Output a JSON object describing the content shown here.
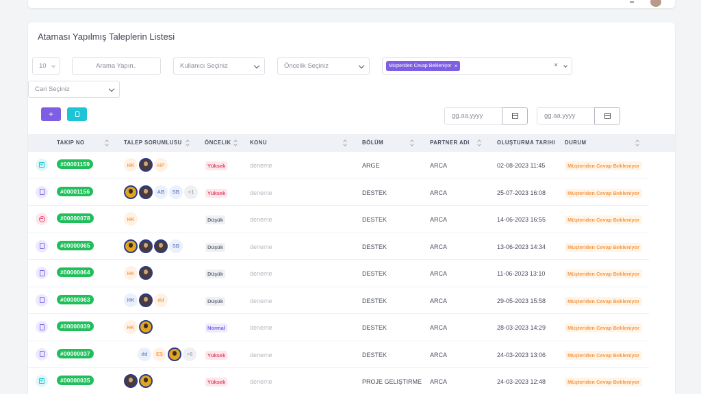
{
  "card": {
    "title": "Ataması Yapılmış Taleplerin Listesi"
  },
  "filters": {
    "page_size": "10",
    "search_placeholder": "Arama Yapın..",
    "user_placeholder": "Kullanıcı Seçiniz",
    "priority_placeholder": "Öncelik Seçiniz",
    "status_tag": "Müşteriden Cevap Bekleniyor",
    "status_tag_remove": "×",
    "status_clear": "×",
    "account_placeholder": "Cari Seçiniz",
    "date_start_placeholder": "gg.aa.yyyy",
    "date_end_placeholder": "gg.aa.yyyy"
  },
  "buttons": {
    "add_label": "+"
  },
  "table": {
    "headers": {
      "takip_no": "TAKIP NO",
      "sorumlu": "TALEP SORUMLUSU",
      "oncelik": "ÖNCELIK",
      "konu": "KONU",
      "bolum": "BÖLÜM",
      "partner": "PARTNER ADI",
      "tarih": "OLUŞTURMA TARIHI",
      "durum": "DURUM"
    },
    "rows": [
      {
        "icon": "check",
        "ticket": "#00001159",
        "assignees": [
          "HK",
          "photo",
          "HP"
        ],
        "priority": "Yüksek",
        "ptype": "high",
        "konu": "deneme",
        "bolum": "ARGE",
        "partner": "ARCA",
        "tarih": "02-08-2023 11:45",
        "durum": "Müşteriden Cevap Bekleniyor"
      },
      {
        "icon": "doc",
        "ticket": "#00001156",
        "assignees": [
          "gold",
          "photo",
          "AB",
          "SB",
          "+1"
        ],
        "priority": "Yüksek",
        "ptype": "high",
        "konu": "deneme",
        "bolum": "DESTEK",
        "partner": "ARCA",
        "tarih": "25-07-2023 16:08",
        "durum": "Müşteriden Cevap Bekleniyor"
      },
      {
        "icon": "minus",
        "ticket": "#00000078",
        "assignees": [
          "HK"
        ],
        "priority": "Düşük",
        "ptype": "low",
        "konu": "deneme",
        "bolum": "DESTEK",
        "partner": "ARCA",
        "tarih": "14-06-2023 16:55",
        "durum": "Müşteriden Cevap Bekleniyor"
      },
      {
        "icon": "doc",
        "ticket": "#00000065",
        "assignees": [
          "gold",
          "photo",
          "photo",
          "SB"
        ],
        "priority": "Düşük",
        "ptype": "low",
        "konu": "deneme",
        "bolum": "DESTEK",
        "partner": "ARCA",
        "tarih": "13-06-2023 14:34",
        "durum": "Müşteriden Cevap Bekleniyor"
      },
      {
        "icon": "doc",
        "ticket": "#00000064",
        "assignees": [
          "HK",
          "photo"
        ],
        "priority": "Düşük",
        "ptype": "low",
        "konu": "deneme",
        "bolum": "DESTEK",
        "partner": "ARCA",
        "tarih": "11-06-2023 13:10",
        "durum": "Müşteriden Cevap Bekleniyor"
      },
      {
        "icon": "doc",
        "ticket": "#00000063",
        "assignees": [
          "HK",
          "photo",
          "dd"
        ],
        "priority": "Düşük",
        "ptype": "low",
        "konu": "deneme",
        "bolum": "DESTEK",
        "partner": "ARCA",
        "tarih": "29-05-2023 15:58",
        "durum": "Müşteriden Cevap Bekleniyor"
      },
      {
        "icon": "doc",
        "ticket": "#00000039",
        "assignees": [
          "HK",
          "gold"
        ],
        "priority": "Normal",
        "ptype": "normal",
        "konu": "deneme",
        "bolum": "DESTEK",
        "partner": "ARCA",
        "tarih": "28-03-2023 14:29",
        "durum": "Müşteriden Cevap Bekleniyor"
      },
      {
        "icon": "doc",
        "ticket": "#00000037",
        "assignees": [
          "dd",
          "EŞ",
          "gold",
          "+6"
        ],
        "priority": "Yüksek",
        "ptype": "high",
        "konu": "deneme",
        "bolum": "DESTEK",
        "partner": "ARCA",
        "tarih": "24-03-2023 13:06",
        "durum": "Müşteriden Cevap Bekleniyor"
      },
      {
        "icon": "check",
        "ticket": "#00000035",
        "assignees": [
          "photo",
          "gold"
        ],
        "priority": "Yüksek",
        "ptype": "high",
        "konu": "deneme",
        "bolum": "PROJE GELIŞTIRME",
        "partner": "ARCA",
        "tarih": "24-03-2023 12:48",
        "durum": "Müşteriden Cevap Bekleniyor"
      }
    ]
  }
}
